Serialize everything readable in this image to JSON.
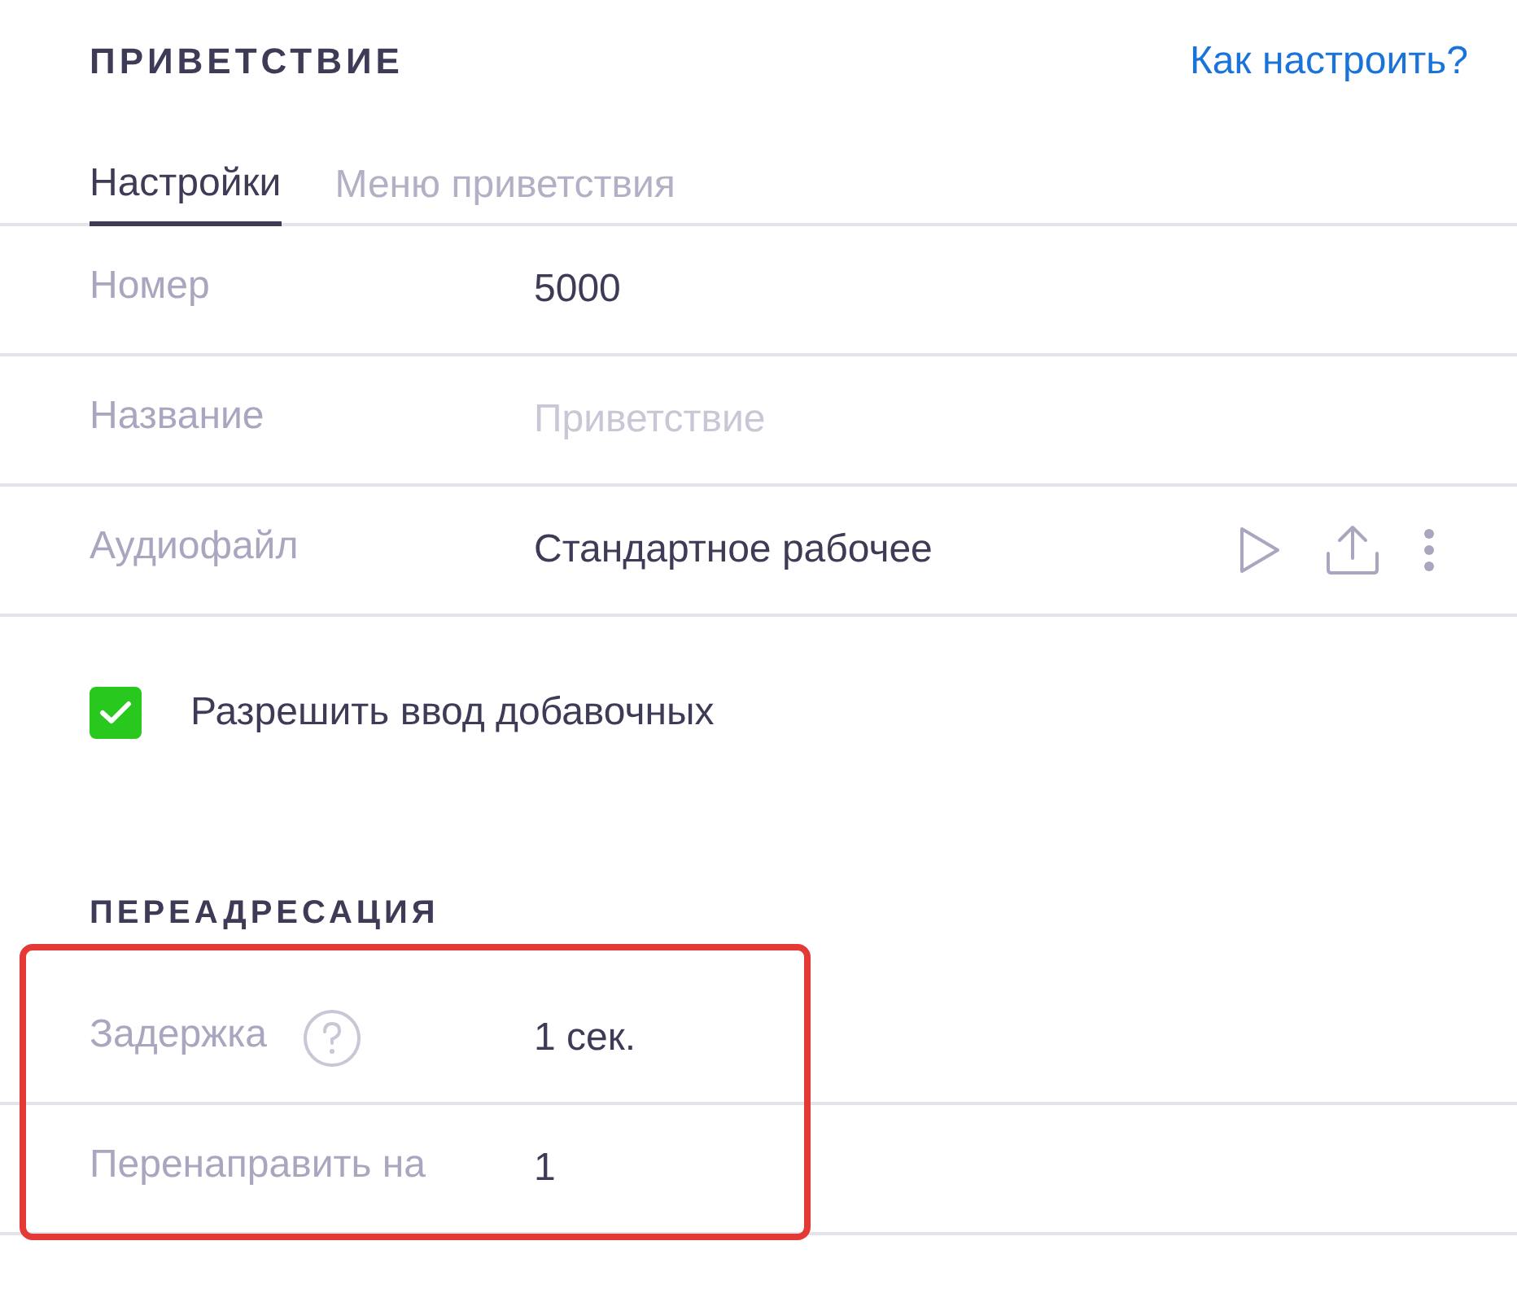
{
  "header": {
    "title": "ПРИВЕТСТВИЕ",
    "help_link": "Как настроить?"
  },
  "tabs": [
    {
      "label": "Настройки",
      "selected": true
    },
    {
      "label": "Меню приветствия",
      "selected": false
    }
  ],
  "settings": [
    {
      "label": "Номер",
      "value": "5000"
    },
    {
      "label": "Название",
      "placeholder": "Приветствие"
    },
    {
      "label": "Аудиофайл",
      "value": "Стандартное рабочее",
      "actions": [
        {
          "kind": "play"
        },
        {
          "kind": "upload"
        },
        {
          "kind": "more"
        }
      ]
    }
  ],
  "allow_extensions": {
    "label": "Разрешить ввод добавочных",
    "checked": true
  },
  "forwarding": {
    "title": "ПЕРЕАДРЕСАЦИЯ",
    "highlighted": true,
    "rows": [
      {
        "label": "Задержка",
        "value": "1 сек.",
        "help": true
      },
      {
        "label": "Перенаправить на",
        "value": "1"
      }
    ]
  }
}
